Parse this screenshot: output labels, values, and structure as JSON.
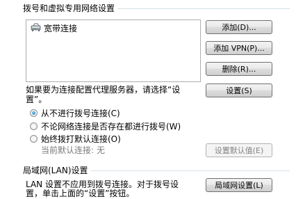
{
  "dial_group": {
    "title": "拨号和虚拟专用网络设置",
    "connections": [
      {
        "label": "宽带连接",
        "icon": "broadband-connection-icon"
      }
    ],
    "add_button": "添加(D)...",
    "add_vpn_button": "添加 VPN(P)...",
    "delete_button": "删除(R)...",
    "proxy_note_line1": "如果要为连接配置代理服务器，请选择“设",
    "proxy_note_line2": "置”。",
    "settings_button": "设置(S)",
    "radio_never": "从不进行拨号连接(C)",
    "radio_when_no_network": "不论网络连接是否存在都进行拨号(W)",
    "radio_always_default": "始终拨打默认连接(O)",
    "current_default_label": "当前默认连接:",
    "current_default_value": "无",
    "set_default_button": "设置默认值(E)",
    "selected_radio": "never"
  },
  "lan_group": {
    "title": "局域网(LAN)设置",
    "note_line1": "LAN 设置不应用到拨号连接。对于拨号设",
    "note_line2": "置，单击上面的“设置”按钮。",
    "lan_settings_button": "局域网设置(L)"
  }
}
